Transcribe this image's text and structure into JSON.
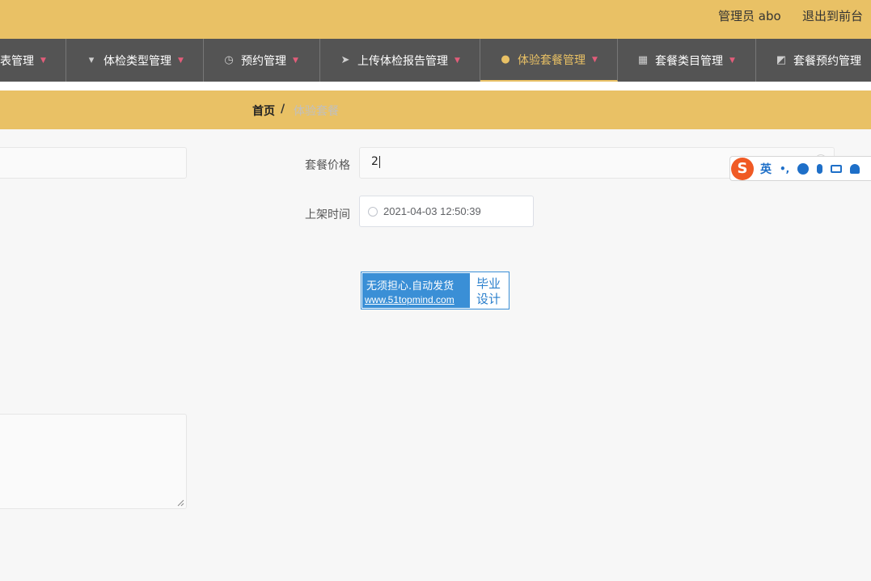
{
  "topbar": {
    "user_label": "管理员 abo",
    "logout_label": "退出到前台",
    "bg_color": "#e9c165"
  },
  "nav": {
    "bg_color": "#545454",
    "active_color": "#e9c165",
    "items": [
      {
        "label": "表管理",
        "icon": "table-icon"
      },
      {
        "label": "体检类型管理",
        "icon": "pin-icon"
      },
      {
        "label": "预约管理",
        "icon": "clock-icon"
      },
      {
        "label": "上传体检报告管理",
        "icon": "send-icon"
      },
      {
        "label": "体验套餐管理",
        "icon": "lightbulb-icon",
        "active": true
      },
      {
        "label": "套餐类目管理",
        "icon": "grid-icon"
      },
      {
        "label": "套餐预约管理",
        "icon": "chart-icon"
      }
    ]
  },
  "breadcrumb": {
    "home": "首页",
    "separator": "/",
    "current": "体验套餐"
  },
  "form": {
    "price_label": "套餐价格",
    "price_value": "2",
    "time_label": "上架时间",
    "time_value": "2021-04-03 12:50:39"
  },
  "ime": {
    "lang": "英",
    "punct": "•,"
  },
  "watermark": {
    "line1": "无须担心.自动发货",
    "line2": "www.51topmind.com",
    "right1": "毕业",
    "right2": "设计"
  }
}
